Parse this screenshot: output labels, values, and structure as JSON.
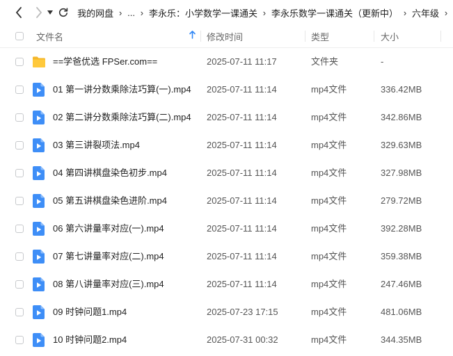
{
  "breadcrumb": {
    "items": [
      "我的网盘",
      "...",
      "李永乐：小学数学一课通关",
      "李永乐数学一课通关（更新中）",
      "六年级"
    ]
  },
  "columns": {
    "name": "文件名",
    "modified": "修改时间",
    "type": "类型",
    "size": "大小"
  },
  "icons": {
    "back": "chevron-left-icon",
    "forward": "chevron-right-icon",
    "history": "caret-down-icon",
    "refresh": "refresh-icon",
    "sort": "sort-ascending-icon",
    "folder": "folder-icon",
    "video": "video-file-icon"
  },
  "colors": {
    "folder": "#FFC93C",
    "video": "#3E8EF7",
    "sort_arrow": "#2F86F6"
  },
  "files": [
    {
      "name": "==学爸优选 FPSer.com==",
      "modified": "2025-07-11 11:17",
      "type": "文件夹",
      "size": "-",
      "kind": "folder"
    },
    {
      "name": "01 第一讲分数乘除法巧算(一).mp4",
      "modified": "2025-07-11 11:14",
      "type": "mp4文件",
      "size": "336.42MB",
      "kind": "video"
    },
    {
      "name": "02 第二讲分数乘除法巧算(二).mp4",
      "modified": "2025-07-11 11:14",
      "type": "mp4文件",
      "size": "342.86MB",
      "kind": "video"
    },
    {
      "name": "03 第三讲裂项法.mp4",
      "modified": "2025-07-11 11:14",
      "type": "mp4文件",
      "size": "329.63MB",
      "kind": "video"
    },
    {
      "name": "04 第四讲棋盘染色初步.mp4",
      "modified": "2025-07-11 11:14",
      "type": "mp4文件",
      "size": "327.98MB",
      "kind": "video"
    },
    {
      "name": "05 第五讲棋盘染色进阶.mp4",
      "modified": "2025-07-11 11:14",
      "type": "mp4文件",
      "size": "279.72MB",
      "kind": "video"
    },
    {
      "name": "06 第六讲量率对应(一).mp4",
      "modified": "2025-07-11 11:14",
      "type": "mp4文件",
      "size": "392.28MB",
      "kind": "video"
    },
    {
      "name": "07 第七讲量率对应(二).mp4",
      "modified": "2025-07-11 11:14",
      "type": "mp4文件",
      "size": "359.38MB",
      "kind": "video"
    },
    {
      "name": "08 第八讲量率对应(三).mp4",
      "modified": "2025-07-11 11:14",
      "type": "mp4文件",
      "size": "247.46MB",
      "kind": "video"
    },
    {
      "name": "09 时钟问题1.mp4",
      "modified": "2025-07-23 17:15",
      "type": "mp4文件",
      "size": "481.06MB",
      "kind": "video"
    },
    {
      "name": "10 时钟问题2.mp4",
      "modified": "2025-07-31 00:32",
      "type": "mp4文件",
      "size": "344.35MB",
      "kind": "video"
    }
  ]
}
